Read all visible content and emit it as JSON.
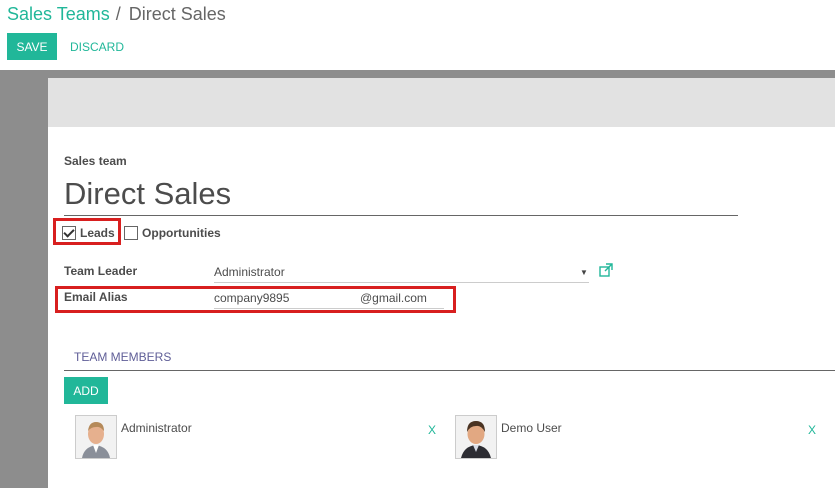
{
  "breadcrumb": {
    "parent": "Sales Teams",
    "separator": "/",
    "current": "Direct Sales"
  },
  "toolbar": {
    "save_label": "SAVE",
    "discard_label": "DISCARD"
  },
  "form": {
    "section_label": "Sales team",
    "name": "Direct Sales",
    "leads": {
      "label": "Leads",
      "checked": true
    },
    "opportunities": {
      "label": "Opportunities",
      "checked": false
    },
    "team_leader": {
      "label": "Team Leader",
      "value": "Administrator"
    },
    "email_alias": {
      "label": "Email Alias",
      "value": "company9895",
      "domain": "@gmail.com"
    }
  },
  "tabs": {
    "members": "TEAM MEMBERS"
  },
  "members": {
    "add_label": "ADD",
    "items": [
      {
        "name": "Administrator",
        "remove": "X"
      },
      {
        "name": "Demo User",
        "remove": "X"
      }
    ]
  },
  "colors": {
    "accent": "#21b799",
    "highlight": "#d81f1f",
    "gutter": "#8d8d8d",
    "statusbar": "#e2e2e2"
  }
}
